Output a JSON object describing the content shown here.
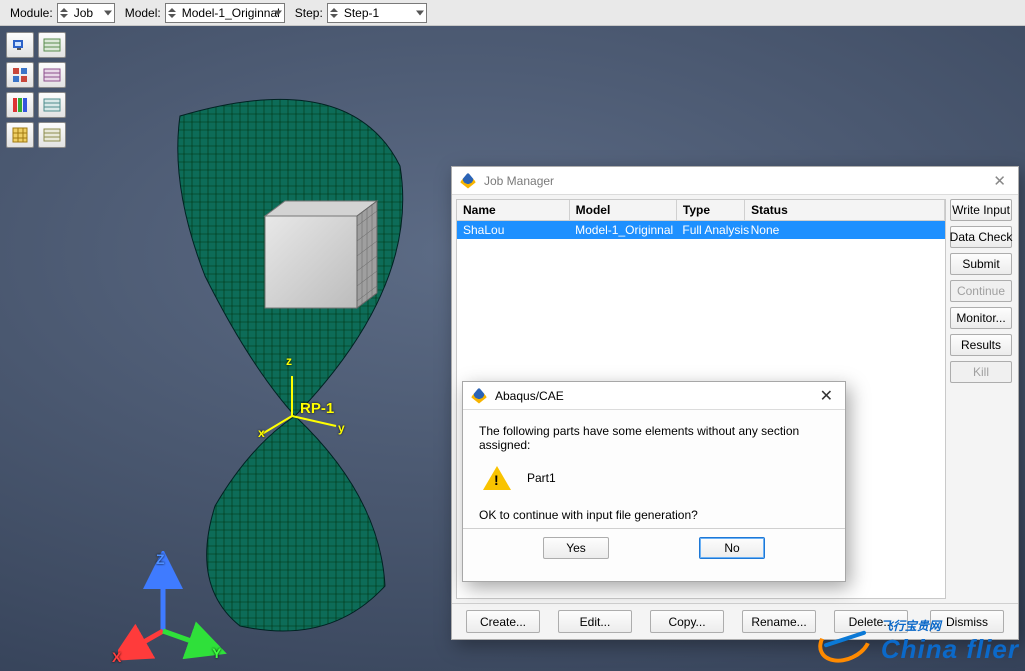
{
  "context_bar": {
    "module_label": "Module:",
    "module_value": "Job",
    "model_label": "Model:",
    "model_value": "Model-1_Originnal",
    "step_label": "Step:",
    "step_value": "Step-1"
  },
  "viewport": {
    "ref_point_label": "RP-1",
    "axis_x": "x",
    "axis_y": "y",
    "axis_z": "z",
    "triad_x": "X",
    "triad_y": "Y",
    "triad_z": "Z"
  },
  "toolbox": {
    "icons": [
      [
        "job-manager-icon",
        "adapt-icon"
      ],
      [
        "cosim-icon",
        "opt-icon"
      ],
      [
        "rgb-icon",
        "table-icon"
      ],
      [
        "grid-icon",
        "matrix-icon"
      ]
    ]
  },
  "job_manager": {
    "title": "Job Manager",
    "columns": [
      "Name",
      "Model",
      "Type",
      "Status"
    ],
    "col_widths": [
      "23%",
      "22%",
      "14%",
      "41%"
    ],
    "rows": [
      {
        "name": "ShaLou",
        "model": "Model-1_Originnal",
        "type": "Full Analysis",
        "status": "None"
      }
    ],
    "side_buttons": [
      {
        "label": "Write Input",
        "enabled": true,
        "name": "write-input-button"
      },
      {
        "label": "Data Check",
        "enabled": true,
        "name": "data-check-button"
      },
      {
        "label": "Submit",
        "enabled": true,
        "name": "submit-button"
      },
      {
        "label": "Continue",
        "enabled": false,
        "name": "continue-button"
      },
      {
        "label": "Monitor...",
        "enabled": true,
        "name": "monitor-button"
      },
      {
        "label": "Results",
        "enabled": true,
        "name": "results-button"
      },
      {
        "label": "Kill",
        "enabled": false,
        "name": "kill-button"
      }
    ],
    "footer_buttons": [
      {
        "label": "Create...",
        "name": "create-button"
      },
      {
        "label": "Edit...",
        "name": "edit-button"
      },
      {
        "label": "Copy...",
        "name": "copy-button"
      },
      {
        "label": "Rename...",
        "name": "rename-button"
      },
      {
        "label": "Delete...",
        "name": "delete-button"
      }
    ],
    "footer_dismiss": {
      "label": "Dismiss",
      "name": "dismiss-button"
    }
  },
  "dialog": {
    "title": "Abaqus/CAE",
    "message": "The following parts have some elements without any section assigned:",
    "part": "Part1",
    "confirm": "OK to continue with input file generation?",
    "yes": "Yes",
    "no": "No"
  },
  "watermark": {
    "brand_top": "飞行宝贵网",
    "brand_main": "China flier"
  }
}
